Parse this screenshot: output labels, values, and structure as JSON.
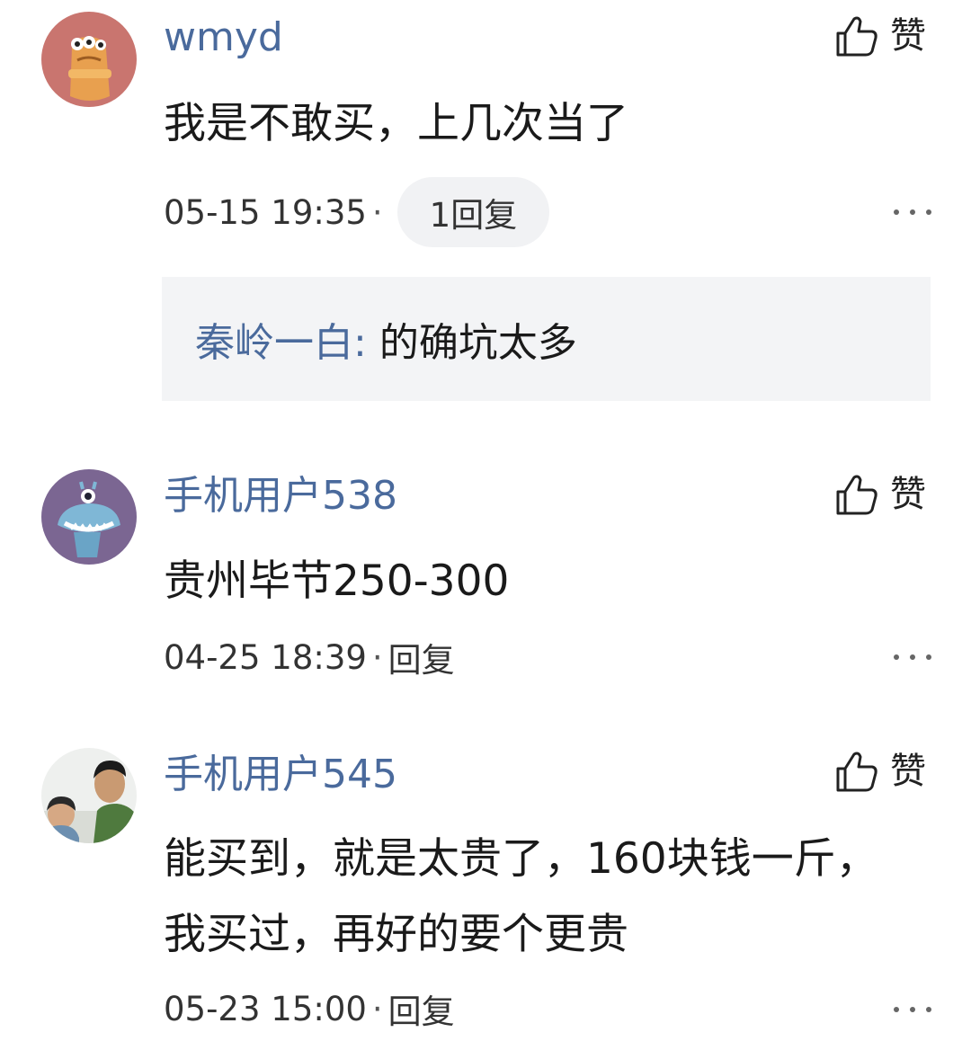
{
  "comments": [
    {
      "username": "wmyd",
      "avatar_icon": "cartoon-creature-avatar",
      "like_label": "赞",
      "content": "我是不敢买，上几次当了",
      "time": "05-15 19:35",
      "separator": "·",
      "reply_label": "1回复",
      "reply": {
        "user": "秦岭一白",
        "colon": ":",
        "text": " 的确坑太多"
      }
    },
    {
      "username": "手机用户538",
      "avatar_icon": "monster-avatar",
      "like_label": "赞",
      "content": "贵州毕节250-300",
      "time": "04-25 18:39",
      "separator": "·",
      "reply_label": "回复"
    },
    {
      "username": "手机用户545",
      "avatar_icon": "photo-avatar",
      "like_label": "赞",
      "content": "能买到，就是太贵了，160块钱一斤，我买过，再好的要个更贵",
      "time": "05-23 15:00",
      "separator": "·",
      "reply_label": "回复"
    }
  ],
  "colors": {
    "username": "#4a6a9c",
    "reply_box_bg": "#f3f4f6",
    "reply_pill_bg": "#f1f2f4"
  }
}
